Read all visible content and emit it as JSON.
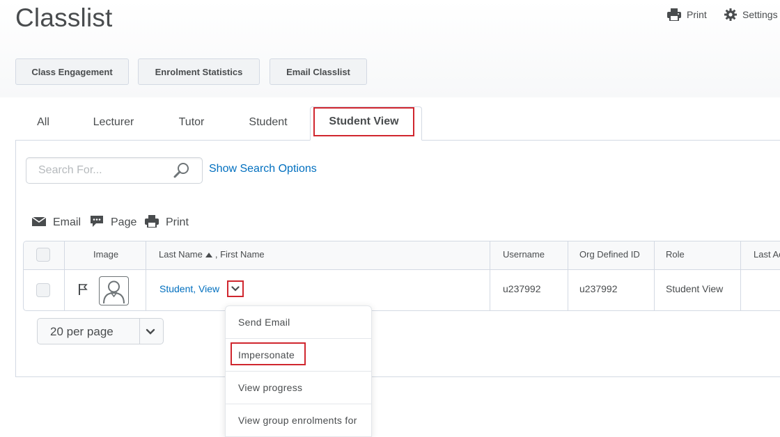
{
  "header": {
    "title": "Classlist",
    "print_label": "Print",
    "settings_label": "Settings"
  },
  "buttons": {
    "class_engagement": "Class Engagement",
    "enrolment_statistics": "Enrolment Statistics",
    "email_classlist": "Email Classlist"
  },
  "tabs": {
    "all": "All",
    "lecturer": "Lecturer",
    "tutor": "Tutor",
    "student": "Student",
    "student_view": "Student View",
    "active": "Student View"
  },
  "search": {
    "placeholder": "Search For...",
    "value": "",
    "show_options": "Show Search Options"
  },
  "actions": {
    "email": "Email",
    "page": "Page",
    "print": "Print"
  },
  "table": {
    "columns": {
      "image": "Image",
      "last_name": "Last Name",
      "first_name": ", First Name",
      "username": "Username",
      "org_defined_id": "Org Defined ID",
      "role": "Role",
      "last_access": "Last Ac"
    },
    "rows": [
      {
        "name": "Student, View",
        "username": "u237992",
        "org_defined_id": "u237992",
        "role": "Student View",
        "last_access": ""
      }
    ]
  },
  "pager": {
    "selected": "20 per page"
  },
  "context_menu": {
    "items": [
      "Send Email",
      "Impersonate",
      "View progress",
      "View group enrolments for"
    ],
    "highlighted": "Impersonate"
  },
  "colors": {
    "accent_link": "#006fbf",
    "highlight_outline": "#d0262e",
    "text": "#494c4e",
    "border": "#d3d9e3"
  },
  "icons": {
    "print": "printer-icon",
    "settings": "gear-icon",
    "search": "magnifier-icon",
    "email": "envelope-icon",
    "page": "chat-bubble-icon",
    "flag": "flag-icon",
    "avatar": "user-silhouette-icon",
    "dropdown": "chevron-down-icon",
    "sort": "sort-ascending-icon"
  }
}
